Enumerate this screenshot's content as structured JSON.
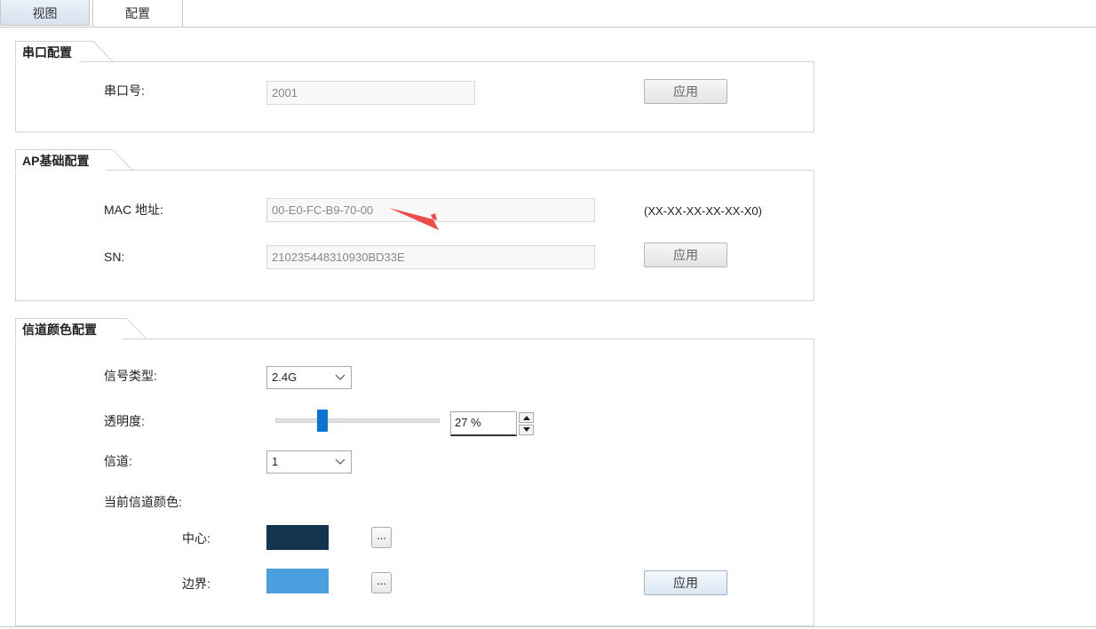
{
  "tabs": [
    {
      "label": "视图"
    },
    {
      "label": "配置"
    }
  ],
  "serial_section": {
    "title": "串口配置",
    "port_label": "串口号:",
    "port_value": "2001",
    "apply_label": "应用"
  },
  "ap_section": {
    "title": "AP基础配置",
    "mac_label": "MAC 地址:",
    "mac_value": "00-E0-FC-B9-70-00",
    "mac_hint": "(XX-XX-XX-XX-XX-X0)",
    "sn_label": "SN:",
    "sn_value": "210235448310930BD33E",
    "apply_label": "应用"
  },
  "channel_section": {
    "title": "信道颜色配置",
    "signal_type_label": "信号类型:",
    "signal_type_value": "2.4G",
    "transparency_label": "透明度:",
    "transparency_value": "27 %",
    "transparency_percent": 27,
    "channel_label": "信道:",
    "channel_value": "1",
    "current_color_label": "当前信道颜色:",
    "center_label": "中心:",
    "center_color": "#12344f",
    "border_label": "边界:",
    "border_color": "#4a9fdf",
    "picker_label": "...",
    "apply_label": "应用"
  },
  "annotation": {
    "arrow_color": "#f04b4b"
  }
}
